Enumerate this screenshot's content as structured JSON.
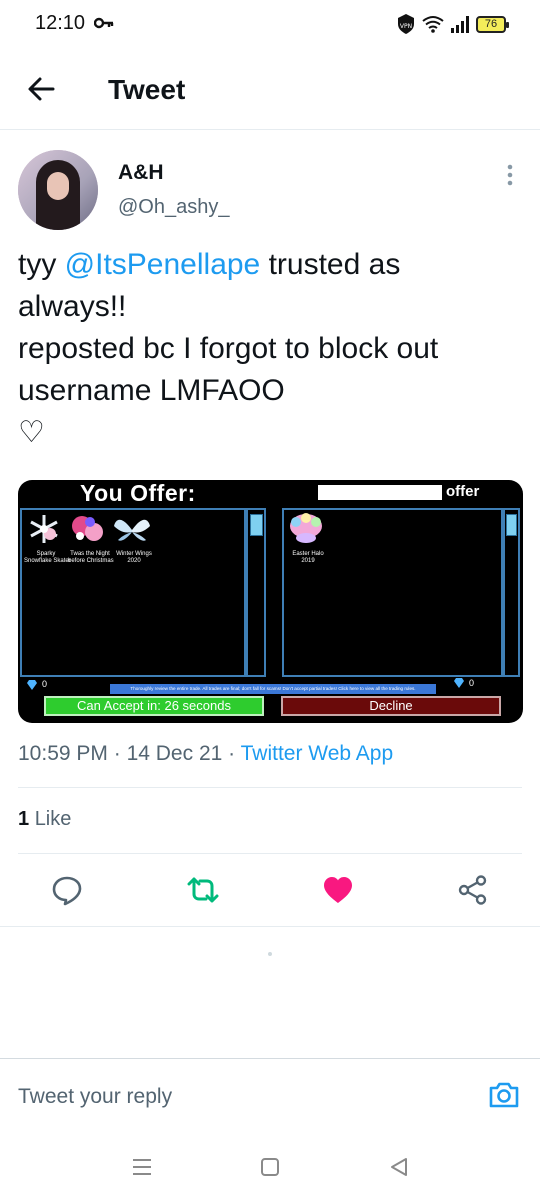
{
  "status_bar": {
    "time": "12:10",
    "battery": "76",
    "icons": [
      "key-icon",
      "vpn-icon",
      "wifi-icon",
      "signal-icon"
    ]
  },
  "header": {
    "title": "Tweet",
    "back_icon": "back-arrow-icon"
  },
  "tweet": {
    "display_name": "A&H",
    "handle": "@Oh_ashy_",
    "text": {
      "prefix": "tyy ",
      "mention": "@ItsPenellape",
      "after_mention": " trusted as",
      "line2": "always!!",
      "line3": "reposted bc I forgot to block out",
      "line4": "username LMFAOO",
      "line5": "♡"
    },
    "time": "10:59 PM",
    "sep1": "·",
    "date": "14 Dec 21",
    "sep2": "·",
    "source": "Twitter Web App",
    "like_count": "1",
    "like_label": "Like"
  },
  "trade_image": {
    "you_offer": "You Offer:",
    "other_offer": "offer",
    "left_items": [
      {
        "line1": "Sparky",
        "line2": "Snowflake Skater"
      },
      {
        "line1": "Twas the Night",
        "line2": "before Christmas"
      },
      {
        "line1": "Winter Wings",
        "line2": "2020"
      }
    ],
    "right_items": [
      {
        "line1": "Easter Halo",
        "line2": "2019"
      }
    ],
    "left_gems": "0",
    "right_gems": "0",
    "warning": "Thoroughly review the entire trade. All trades are final; don't fall for scams! Don't accept partial trades! Click here to view all the trading rules.",
    "accept": "Can Accept in: 26 seconds",
    "decline": "Decline"
  },
  "actions": [
    "reply-icon",
    "retweet-icon",
    "like-icon",
    "share-icon"
  ],
  "colors": {
    "accent": "#1d9bf0",
    "retweet": "#00ba7c",
    "like": "#f91880"
  },
  "reply": {
    "placeholder": "Tweet your reply"
  }
}
